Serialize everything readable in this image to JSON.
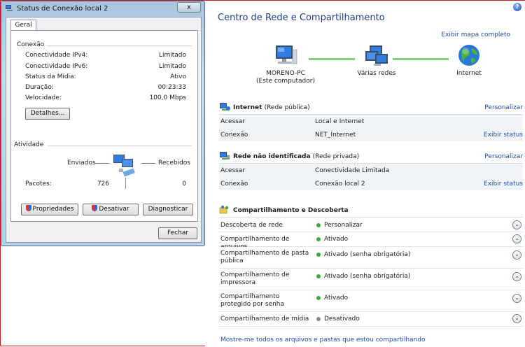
{
  "network_center": {
    "title": "Centro de Rede e Compartilhamento",
    "help_icon": "?",
    "map_link": "Exibir mapa completo",
    "nodes": [
      {
        "label": "MORENO-PC",
        "sub": "(Este computador)"
      },
      {
        "label": "Várias redes"
      },
      {
        "label": "Internet"
      }
    ],
    "networks": [
      {
        "name": "Internet",
        "type": "(Rede pública)",
        "action": "Personalizar",
        "rows": [
          {
            "key": "Acessar",
            "value": "Local e Internet"
          },
          {
            "key": "Conexão",
            "value": "NET_Internet",
            "link": "Exibir status"
          }
        ]
      },
      {
        "name": "Rede não identificada",
        "type": "(Rede privada)",
        "action": "Personalizar",
        "rows": [
          {
            "key": "Acessar",
            "value": "Conectividade Limitada"
          },
          {
            "key": "Conexão",
            "value": "Conexão local 2",
            "link": "Exibir status"
          }
        ]
      }
    ],
    "sharing": {
      "title": "Compartilhamento e Descoberta",
      "items": [
        {
          "key": "Descoberta de rede",
          "value": "Personalizar",
          "status": "on"
        },
        {
          "key": "Compartilhamento de arquivos",
          "value": "Ativado",
          "status": "on"
        },
        {
          "key": "Compartilhamento de pasta pública",
          "value": "Ativado (senha obrigatória)",
          "status": "on"
        },
        {
          "key": "Compartilhamento de impressora",
          "value": "Ativado (senha obrigatória)",
          "status": "on"
        },
        {
          "key": "Compartilhamento protegido por senha",
          "value": "Ativado",
          "status": "on"
        },
        {
          "key": "Compartilhamento de mídia",
          "value": "Desativado",
          "status": "off"
        }
      ]
    },
    "show_all_link": "Mostre-me todos os arquivos e pastas que estou compartilhando",
    "colors": {
      "link": "#1f4fae",
      "title": "#1e3d8c",
      "status_on": "#3aa83a",
      "status_off": "#8c8c8c",
      "map_line": "#7ed07a"
    }
  },
  "dialog": {
    "title": "Status de Conexão local 2",
    "close_label": "x",
    "tab": "Geral",
    "connection_group": "Conexão",
    "connection": [
      {
        "key": "Conectividade IPv4:",
        "value": "Limitado"
      },
      {
        "key": "Conectividade IPv6:",
        "value": "Limitado"
      },
      {
        "key": "Status da Mídia:",
        "value": "Ativo"
      },
      {
        "key": "Duração:",
        "value": "00:23:33"
      },
      {
        "key": "Velocidade:",
        "value": "100,0 Mbps"
      }
    ],
    "details_button": "Detalhes...",
    "activity_group": "Atividade",
    "sent_label": "Enviados",
    "received_label": "Recebidos",
    "packets_label": "Pacotes:",
    "packets_sent": "726",
    "packets_received": "0",
    "properties_button": "Propriedades",
    "disable_button": "Desativar",
    "diagnose_button": "Diagnosticar",
    "close_button": "Fechar"
  }
}
